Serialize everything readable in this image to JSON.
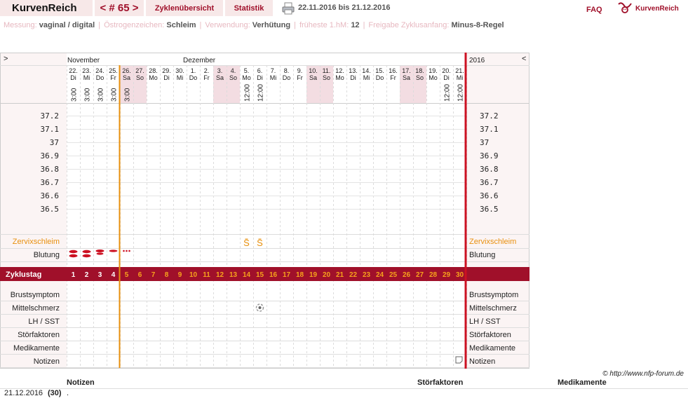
{
  "header": {
    "app_title": "KurvenReich",
    "cycle_nav": "< # 65 >",
    "tab_overview": "Zyklenübersicht",
    "tab_stats": "Statistik",
    "date_range": "22.11.2016 bis 21.12.2016",
    "faq": "FAQ",
    "logo_text": "KurvenReich"
  },
  "settings": [
    {
      "label": "Messung:",
      "value": "vaginal / digital"
    },
    {
      "label": "Östrogenzeichen:",
      "value": "Schleim"
    },
    {
      "label": "Verwendung:",
      "value": "Verhütung"
    },
    {
      "label": "früheste 1.hM:",
      "value": "12"
    },
    {
      "label": "Freigabe Zyklusanfang:",
      "value": "Minus-8-Regel"
    }
  ],
  "chart": {
    "nav_left": ">",
    "nav_right": "<",
    "year": "2016",
    "months": [
      {
        "label": "November",
        "day_index": 0
      },
      {
        "label": "Dezember",
        "day_index": 9
      }
    ],
    "days": [
      {
        "num": "22.",
        "wd": "Di",
        "time": "3:00"
      },
      {
        "num": "23.",
        "wd": "Mi",
        "time": "3:00"
      },
      {
        "num": "24.",
        "wd": "Do",
        "time": "3:00"
      },
      {
        "num": "25.",
        "wd": "Fr",
        "time": "3:00"
      },
      {
        "num": "26.",
        "wd": "Sa",
        "time": "3:00",
        "weekend": true
      },
      {
        "num": "27.",
        "wd": "So",
        "time": "",
        "weekend": true
      },
      {
        "num": "28.",
        "wd": "Mo",
        "time": ""
      },
      {
        "num": "29.",
        "wd": "Di",
        "time": ""
      },
      {
        "num": "30.",
        "wd": "Mi",
        "time": ""
      },
      {
        "num": "1.",
        "wd": "Do",
        "time": ""
      },
      {
        "num": "2.",
        "wd": "Fr",
        "time": ""
      },
      {
        "num": "3.",
        "wd": "Sa",
        "time": "",
        "weekend": true
      },
      {
        "num": "4.",
        "wd": "So",
        "time": "",
        "weekend": true
      },
      {
        "num": "5.",
        "wd": "Mo",
        "time": "12:00"
      },
      {
        "num": "6.",
        "wd": "Di",
        "time": "12:00"
      },
      {
        "num": "7.",
        "wd": "Mi",
        "time": ""
      },
      {
        "num": "8.",
        "wd": "Do",
        "time": ""
      },
      {
        "num": "9.",
        "wd": "Fr",
        "time": ""
      },
      {
        "num": "10.",
        "wd": "Sa",
        "time": "",
        "weekend": true
      },
      {
        "num": "11.",
        "wd": "So",
        "time": "",
        "weekend": true
      },
      {
        "num": "12.",
        "wd": "Mo",
        "time": ""
      },
      {
        "num": "13.",
        "wd": "Di",
        "time": ""
      },
      {
        "num": "14.",
        "wd": "Mi",
        "time": ""
      },
      {
        "num": "15.",
        "wd": "Do",
        "time": ""
      },
      {
        "num": "16.",
        "wd": "Fr",
        "time": ""
      },
      {
        "num": "17.",
        "wd": "Sa",
        "time": "",
        "weekend": true
      },
      {
        "num": "18.",
        "wd": "So",
        "time": "",
        "weekend": true
      },
      {
        "num": "19.",
        "wd": "Mo",
        "time": ""
      },
      {
        "num": "20.",
        "wd": "Di",
        "time": "12:00"
      },
      {
        "num": "21.",
        "wd": "Mi",
        "time": "12:00"
      }
    ],
    "temp_labels": [
      "37.2",
      "37.1",
      "37",
      "36.9",
      "36.8",
      "36.7",
      "36.6",
      "36.5"
    ],
    "row_labels": {
      "cervical": "Zervixschleim",
      "bleeding": "Blutung",
      "cycle_day": "Zyklustag",
      "breast": "Brustsymptom",
      "midpain": "Mittelschmerz",
      "lh": "LH / SST",
      "disturb": "Störfaktoren",
      "meds": "Medikamente",
      "notes": "Notizen"
    },
    "cycle_days": [
      "1",
      "2",
      "3",
      "4",
      "5",
      "6",
      "7",
      "8",
      "9",
      "10",
      "11",
      "12",
      "13",
      "14",
      "15",
      "16",
      "17",
      "18",
      "19",
      "20",
      "21",
      "22",
      "23",
      "24",
      "25",
      "26",
      "27",
      "28",
      "29",
      "30"
    ],
    "cervical_marks": [
      {
        "day_index": 13,
        "symbol": "S"
      },
      {
        "day_index": 14,
        "symbol": "S"
      }
    ],
    "bleeding": [
      {
        "day_index": 0,
        "level": "strong"
      },
      {
        "day_index": 1,
        "level": "strong"
      },
      {
        "day_index": 2,
        "level": "medium"
      },
      {
        "day_index": 3,
        "level": "light"
      },
      {
        "day_index": 4,
        "level": "spotting"
      }
    ],
    "midpain_day_index": 14,
    "note_day_index": 29,
    "colors": {
      "accent": "#a0102a",
      "orange": "#e8900e",
      "weekend": "#f3dde2",
      "grid": "#dcdcdc"
    }
  },
  "footer": {
    "credit": "© http://www.nfp-forum.de",
    "col_notes": "Notizen",
    "col_disturb": "Störfaktoren",
    "col_meds": "Medikamente",
    "row_date": "21.12.2016",
    "row_count": "(30)",
    "row_text": "."
  }
}
